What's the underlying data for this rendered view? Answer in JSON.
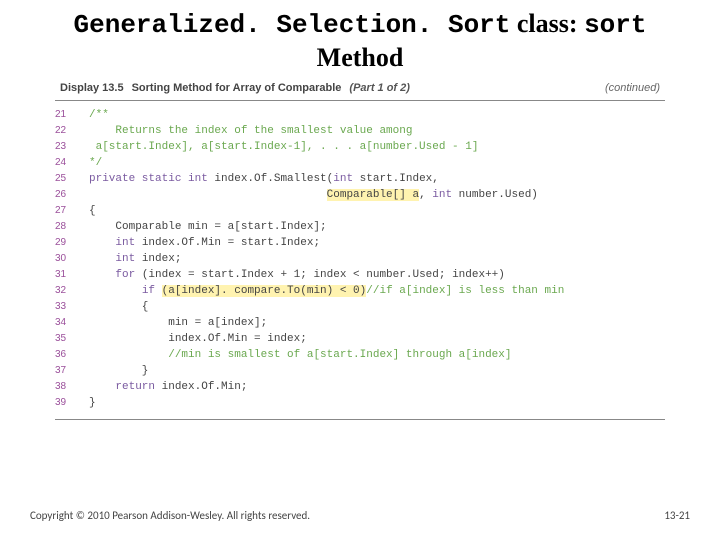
{
  "title": {
    "part1": "Generalized. Selection. Sort",
    "joiner": " class: ",
    "part2": "sort",
    "line2": "Method"
  },
  "display": {
    "label": "Display 13.5",
    "name": "Sorting Method for Array of Comparable",
    "part": "(Part 1 of 2)",
    "continued": "(continued)"
  },
  "code": {
    "lines": [
      {
        "n": "21",
        "segs": [
          {
            "cls": "cmt",
            "t": "/**"
          }
        ]
      },
      {
        "n": "22",
        "segs": [
          {
            "cls": "cmt",
            "t": "    Returns the index of the smallest value among"
          }
        ]
      },
      {
        "n": "23",
        "segs": [
          {
            "cls": "cmt",
            "t": " a[start.Index], a[start.Index-1], . . . a[number.Used - 1]"
          }
        ]
      },
      {
        "n": "24",
        "segs": [
          {
            "cls": "cmt",
            "t": "*/"
          }
        ]
      },
      {
        "n": "25",
        "segs": [
          {
            "cls": "kw",
            "t": "private static int"
          },
          {
            "cls": "",
            "t": " index.Of.Smallest("
          },
          {
            "cls": "kw",
            "t": "int"
          },
          {
            "cls": "",
            "t": " start.Index,"
          }
        ]
      },
      {
        "n": "26",
        "segs": [
          {
            "cls": "",
            "t": "                                    "
          },
          {
            "cls": "hl",
            "t": "Comparable[] a"
          },
          {
            "cls": "",
            "t": ", "
          },
          {
            "cls": "kw",
            "t": "int"
          },
          {
            "cls": "",
            "t": " number.Used)"
          }
        ]
      },
      {
        "n": "27",
        "segs": [
          {
            "cls": "",
            "t": "{"
          }
        ]
      },
      {
        "n": "28",
        "segs": [
          {
            "cls": "",
            "t": "    Comparable min = a[start.Index];"
          }
        ]
      },
      {
        "n": "29",
        "segs": [
          {
            "cls": "",
            "t": "    "
          },
          {
            "cls": "kw",
            "t": "int"
          },
          {
            "cls": "",
            "t": " index.Of.Min = start.Index;"
          }
        ]
      },
      {
        "n": "30",
        "segs": [
          {
            "cls": "",
            "t": "    "
          },
          {
            "cls": "kw",
            "t": "int"
          },
          {
            "cls": "",
            "t": " index;"
          }
        ]
      },
      {
        "n": "31",
        "segs": [
          {
            "cls": "",
            "t": "    "
          },
          {
            "cls": "kw",
            "t": "for"
          },
          {
            "cls": "",
            "t": " (index = start.Index + 1; index < number.Used; index++)"
          }
        ]
      },
      {
        "n": "32",
        "segs": [
          {
            "cls": "",
            "t": "        "
          },
          {
            "cls": "kw",
            "t": "if"
          },
          {
            "cls": "",
            "t": " "
          },
          {
            "cls": "hl",
            "t": "(a[index]. compare.To(min) < 0)"
          },
          {
            "cls": "cmt",
            "t": "//if a[index] is less than min"
          }
        ]
      },
      {
        "n": "33",
        "segs": [
          {
            "cls": "",
            "t": "        {"
          }
        ]
      },
      {
        "n": "34",
        "segs": [
          {
            "cls": "",
            "t": "            min = a[index];"
          }
        ]
      },
      {
        "n": "35",
        "segs": [
          {
            "cls": "",
            "t": "            index.Of.Min = index;"
          }
        ]
      },
      {
        "n": "36",
        "segs": [
          {
            "cls": "",
            "t": "            "
          },
          {
            "cls": "cmt",
            "t": "//min is smallest of a[start.Index] through a[index]"
          }
        ]
      },
      {
        "n": "37",
        "segs": [
          {
            "cls": "",
            "t": "        }"
          }
        ]
      },
      {
        "n": "38",
        "segs": [
          {
            "cls": "",
            "t": "    "
          },
          {
            "cls": "kw",
            "t": "return"
          },
          {
            "cls": "",
            "t": " index.Of.Min;"
          }
        ]
      },
      {
        "n": "39",
        "segs": [
          {
            "cls": "",
            "t": "}"
          }
        ]
      }
    ]
  },
  "footer": {
    "copyright": "Copyright © 2010 Pearson Addison-Wesley. All rights reserved.",
    "pagenum": "13-21"
  }
}
